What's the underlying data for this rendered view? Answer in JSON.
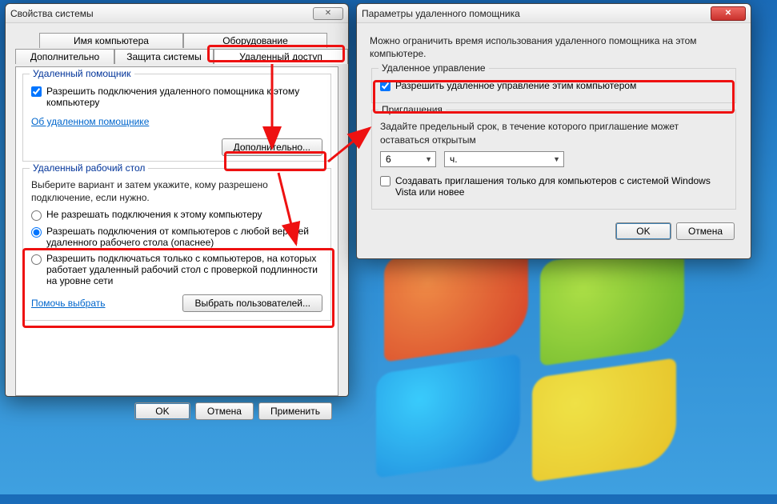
{
  "left_window": {
    "title": "Свойства системы",
    "tabs_top": [
      "Имя компьютера",
      "Оборудование"
    ],
    "tabs_bottom": [
      "Дополнительно",
      "Защита системы",
      "Удаленный доступ"
    ],
    "assist_group": {
      "legend": "Удаленный помощник",
      "allow_label": "Разрешить подключения удаленного помощника к этому компьютеру",
      "about_link": "Об удаленном помощнике",
      "advanced_btn": "Дополнительно..."
    },
    "rdp_group": {
      "legend": "Удаленный рабочий стол",
      "instruction": "Выберите вариант и затем укажите, кому разрешено подключение, если нужно.",
      "opt_none": "Не разрешать подключения к этому компьютеру",
      "opt_any": "Разрешать подключения от компьютеров с любой версией удаленного рабочего стола (опаснее)",
      "opt_nla": "Разрешить подключаться только с компьютеров, на которых работает удаленный рабочий стол с проверкой подлинности на уровне сети",
      "help_link": "Помочь выбрать",
      "select_users_btn": "Выбрать пользователей..."
    },
    "buttons": {
      "ok": "OK",
      "cancel": "Отмена",
      "apply": "Применить"
    }
  },
  "right_window": {
    "title": "Параметры удаленного помощника",
    "intro": "Можно ограничить время использования удаленного помощника на этом компьютере.",
    "control_group": {
      "legend": "Удаленное управление",
      "allow_label": "Разрешить удаленное управление этим компьютером"
    },
    "invite_group": {
      "legend": "Приглашения",
      "instruction": "Задайте предельный срок, в течение которого приглашение может оставаться открытым",
      "value": "6",
      "unit": "ч.",
      "vista_label": "Создавать приглашения только для компьютеров с системой Windows Vista или новее"
    },
    "buttons": {
      "ok": "OK",
      "cancel": "Отмена"
    }
  }
}
